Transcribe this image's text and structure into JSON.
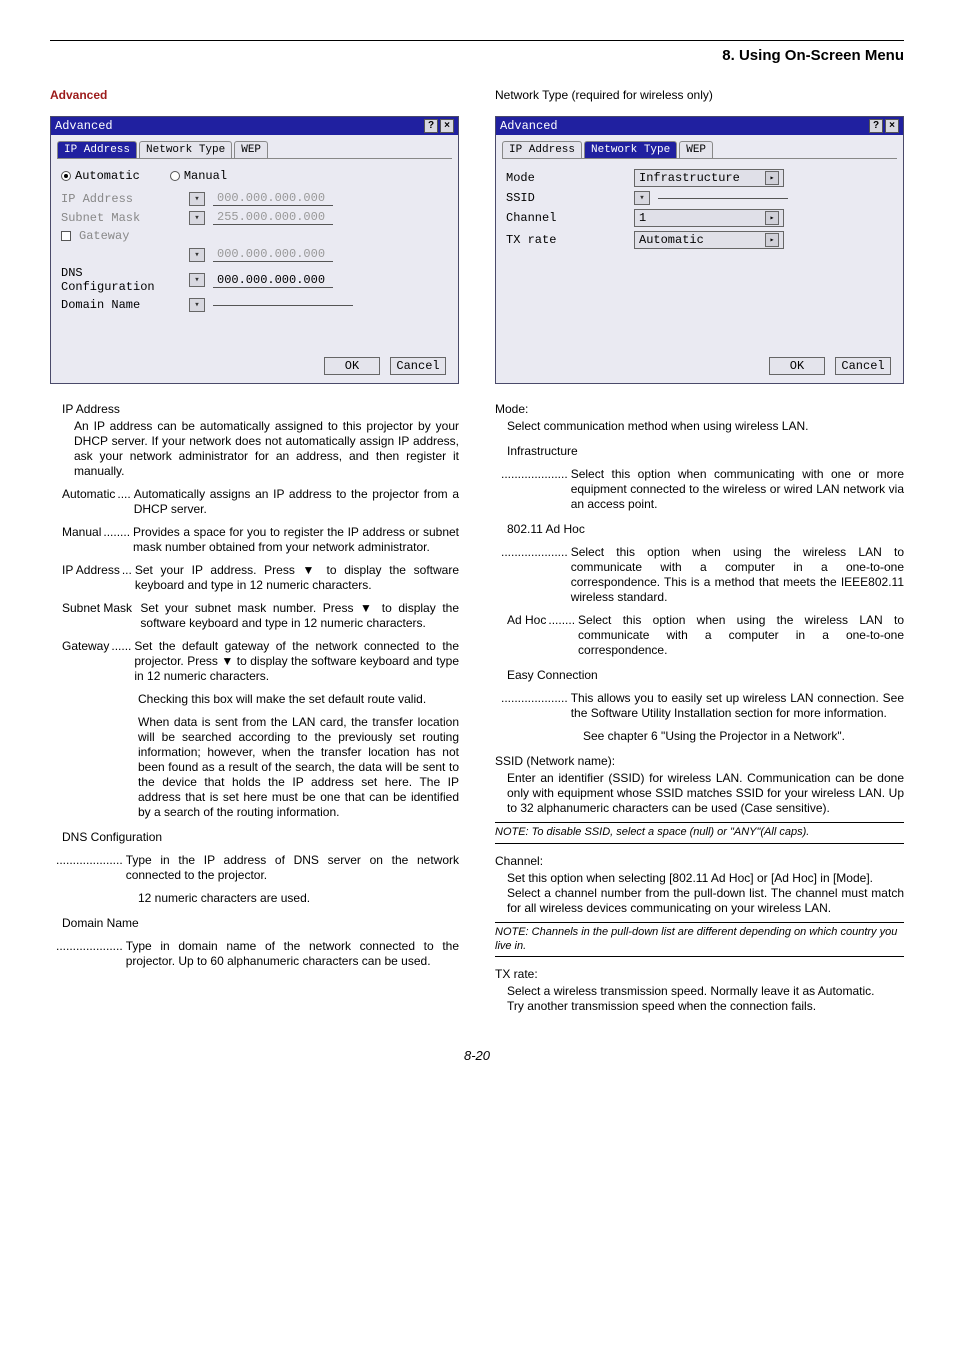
{
  "header": {
    "section_title": "8. Using On-Screen Menu"
  },
  "left": {
    "heading": "Advanced",
    "dialog": {
      "title": "Advanced",
      "tabs": {
        "t1": "IP Address",
        "t2": "Network Type",
        "t3": "WEP"
      },
      "radio_auto": "Automatic",
      "radio_manual": "Manual",
      "lbl_ip": "IP Address",
      "val_ip": "000.000.000.000",
      "lbl_subnet": "Subnet Mask",
      "val_subnet": "255.000.000.000",
      "lbl_gateway": "Gateway",
      "val_gateway_blank": "",
      "val_gateway2": "000.000.000.000",
      "lbl_dns": "DNS Configuration",
      "val_dns": "000.000.000.000",
      "lbl_domain": "Domain Name",
      "val_domain": "",
      "btn_ok": "OK",
      "btn_cancel": "Cancel"
    },
    "text": {
      "ip_head": "IP Address",
      "ip_body": "An IP address can be automatically assigned to this projector by your DHCP server. If your network does not automatically assign IP address, ask your network administrator for an address, and then register it manually.",
      "automatic_t": "Automatic",
      "automatic_d": "Automatically assigns an IP address to the projector from a DHCP server.",
      "manual_t": "Manual",
      "manual_d": "Provides a space for you to register the IP address or subnet mask number obtained from your network administrator.",
      "ipaddr_t": "IP Address",
      "ipaddr_d": "Set your IP address. Press ▼ to display the software keyboard and type in 12 numeric characters.",
      "subnet_t": "Subnet Mask",
      "subnet_d": "Set your subnet mask number. Press ▼ to display the software keyboard and type in 12 numeric characters.",
      "gateway_t": "Gateway",
      "gateway_d": "Set the default gateway of the network connected to the projector. Press ▼ to display the software keyboard and type in 12 numeric characters.",
      "gateway_c1": "Checking this box will make the set default route valid.",
      "gateway_c2": "When data is sent from the LAN card, the transfer location will be searched according to the previously set routing information; however, when the transfer location has not been found as a result of the search, the data will be sent to the device that holds the IP address set here. The IP address that is set here must be one that can be identified by a search of the routing information.",
      "dns_head": "DNS Configuration",
      "dns_d": "Type in the IP address of DNS server on the network connected to the projector.",
      "dns_c": "12 numeric characters are used.",
      "domain_head": "Domain Name",
      "domain_d": "Type in domain name of the network connected to the projector. Up to 60 alphanumeric characters can be used."
    }
  },
  "right": {
    "heading": "Network Type (required for wireless only)",
    "dialog": {
      "title": "Advanced",
      "tabs": {
        "t1": "IP Address",
        "t2": "Network Type",
        "t3": "WEP"
      },
      "lbl_mode": "Mode",
      "val_mode": "Infrastructure",
      "lbl_ssid": "SSID",
      "lbl_channel": "Channel",
      "val_channel": "1",
      "lbl_tx": "TX rate",
      "val_tx": "Automatic",
      "btn_ok": "OK",
      "btn_cancel": "Cancel"
    },
    "text": {
      "mode_head": "Mode:",
      "mode_body": "Select communication method when using wireless LAN.",
      "infra_head": "Infrastructure",
      "infra_d": "Select this option when communicating with one or more equipment connected to the wireless or wired LAN network via an access point.",
      "adhoc_head": "802.11 Ad Hoc",
      "adhoc_d1": "Select this option when using the wireless LAN to communicate with a computer in a one-to-one correspondence. This is a method that meets the IEEE802.11 wireless standard.",
      "adhoc_t": "Ad Hoc",
      "adhoc_d2": "Select this option when using the wireless LAN to communicate with a computer in a one-to-one correspondence.",
      "easy_head": "Easy Connection",
      "easy_d": "This allows you to easily set up wireless LAN connection. See the Software Utility Installation section for more information.",
      "easy_c": "See chapter 6 \"Using the Projector in a Network\".",
      "ssid_head": "SSID (Network name):",
      "ssid_body": "Enter an identifier (SSID) for wireless LAN. Communication can be done only with equipment whose SSID matches SSID for your wireless LAN. Up to 32 alphanumeric characters can be used (Case sensitive).",
      "ssid_note": "NOTE: To disable SSID, select a space (null) or \"ANY\"(All caps).",
      "channel_head": "Channel:",
      "channel_body1": "Set this option when selecting [802.11 Ad Hoc] or [Ad Hoc] in [Mode].",
      "channel_body2": "Select a channel number from the pull-down list. The channel must match for all wireless devices communicating on your wireless LAN.",
      "channel_note": "NOTE: Channels in the pull-down list are different depending on which country you live in.",
      "tx_head": "TX rate:",
      "tx_body1": "Select a wireless transmission speed. Normally leave it as Automatic.",
      "tx_body2": "Try another transmission speed when the connection fails."
    }
  },
  "page_number": "8-20",
  "dots": {
    "d4": "....",
    "d6": "......",
    "d7": ".......",
    "d8": "........",
    "d3s": "...",
    "lead": "...................."
  }
}
